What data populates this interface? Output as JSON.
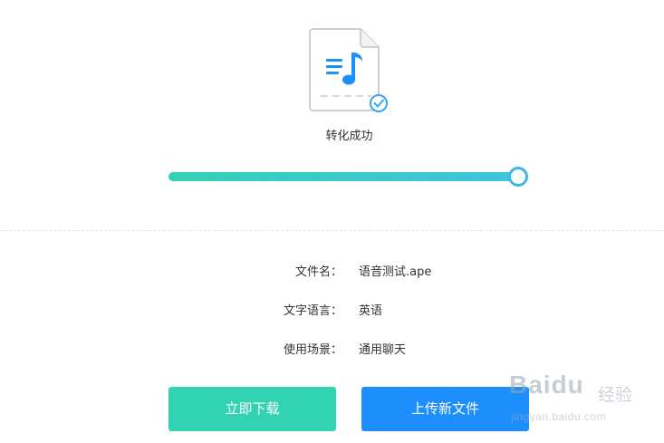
{
  "status": {
    "text": "转化成功",
    "icon": "audio-file-check-icon",
    "progress": 1.0
  },
  "info": {
    "rows": [
      {
        "label": "文件名：",
        "value": "语音测试.ape"
      },
      {
        "label": "文字语言：",
        "value": "英语"
      },
      {
        "label": "使用场景：",
        "value": "通用聊天"
      }
    ]
  },
  "actions": {
    "download_label": "立即下载",
    "upload_label": "上传新文件"
  },
  "watermark": {
    "brand": "Baidu",
    "label": "经验",
    "url": "jingyan.baidu.com"
  },
  "colors": {
    "download_button": "#32d3b3",
    "upload_button": "#1d8ffc",
    "progress_start": "#33d1b6",
    "progress_end": "#3fc3dd",
    "icon_accent": "#1d8ffc"
  }
}
